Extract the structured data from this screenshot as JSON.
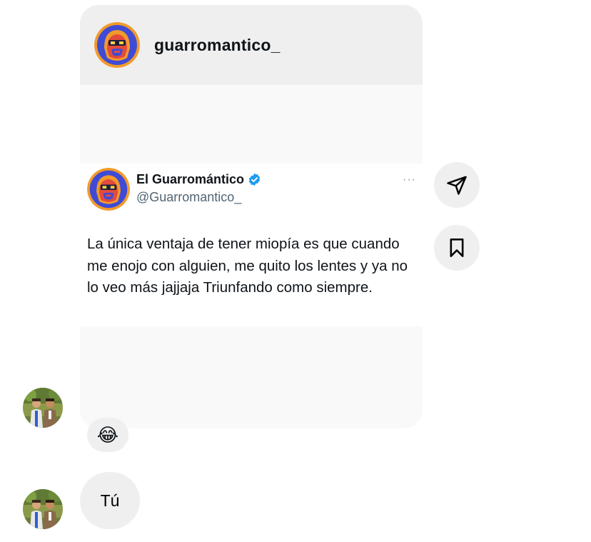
{
  "shared_post": {
    "username": "guarromantico_",
    "tweet": {
      "display_name": "El Guarromántico",
      "handle": "@Guarromantico_",
      "more_icon": "···",
      "verified_icon": "verified-badge-icon",
      "text": "La única ventaja de tener miopía es que cuando me enojo con alguien, me quito los lentes y ya no lo veo más jajjaja Triunfando como siempre."
    }
  },
  "actions": {
    "share_icon": "paper-plane-icon",
    "save_icon": "bookmark-icon"
  },
  "messages": [
    {
      "type": "reaction",
      "emoji": "😂"
    },
    {
      "type": "text",
      "text": "Tú"
    }
  ],
  "colors": {
    "header_bg": "#efefef",
    "handle_gray": "#536471",
    "verified_blue": "#1d9bf0",
    "logo_blue": "#3f4bd6",
    "logo_orange": "#f29b2b",
    "logo_red": "#e44b3c"
  }
}
